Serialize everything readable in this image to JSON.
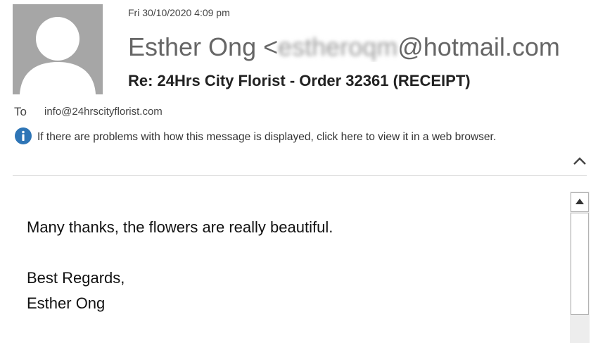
{
  "header": {
    "date": "Fri 30/10/2020 4:09 pm",
    "sender_name": "Esther Ong",
    "sender_open": "<",
    "sender_email_obscured": "estheroqm",
    "sender_domain": "@hotmail.com",
    "subject": "Re: 24Hrs City Florist - Order 32361 (RECEIPT)"
  },
  "recipients": {
    "to_label": "To",
    "to_address": "info@24hrscityflorist.com"
  },
  "info_bar": {
    "message": "If there are problems with how this message is displayed, click here to view it in a web browser."
  },
  "message_body": {
    "line1": "Many thanks, the flowers are really beautiful.",
    "line2": "Best Regards,",
    "line3": "Esther Ong"
  },
  "icons": {
    "avatar": "person-placeholder-icon",
    "info": "info-icon",
    "collapse": "chevron-up-icon",
    "scroll_up": "scroll-up-arrow-icon"
  },
  "colors": {
    "avatar_bg": "#a6a6a6",
    "info_blue": "#2e75b6",
    "text_dark": "#262626"
  }
}
